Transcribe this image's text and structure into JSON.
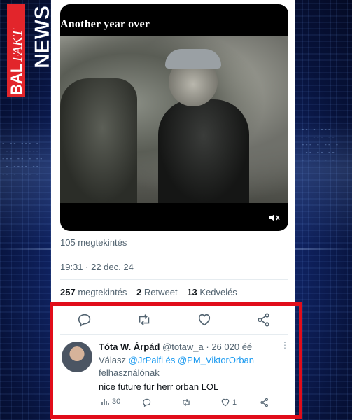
{
  "logo": {
    "part1": "BAL",
    "part2": "FAKT",
    "part3": "NEWS"
  },
  "video": {
    "title": "Another year over"
  },
  "tweet": {
    "views_line": "105 megtekintés",
    "timestamp": "19:31 · 22 dec. 24",
    "stats": {
      "views_count": "257",
      "views_label": "megtekintés",
      "retweets_count": "2",
      "retweets_label": "Retweet",
      "likes_count": "13",
      "likes_label": "Kedvelés"
    }
  },
  "reply": {
    "name": "Tóta W. Árpád",
    "handle": "@totaw_a",
    "time": "· 26 020 éé",
    "reply_prefix": "Válasz",
    "mention1": "@JrPalfi",
    "joiner": "és",
    "mention2": "@PM_ViktorOrban",
    "reply_suffix": "felhasználónak",
    "text": "nice future für herr orban LOL",
    "views": "30",
    "likes": "1"
  },
  "colors": {
    "highlight": "#e10d1a",
    "link": "#1d9bf0",
    "logo_red": "#e2252b"
  }
}
